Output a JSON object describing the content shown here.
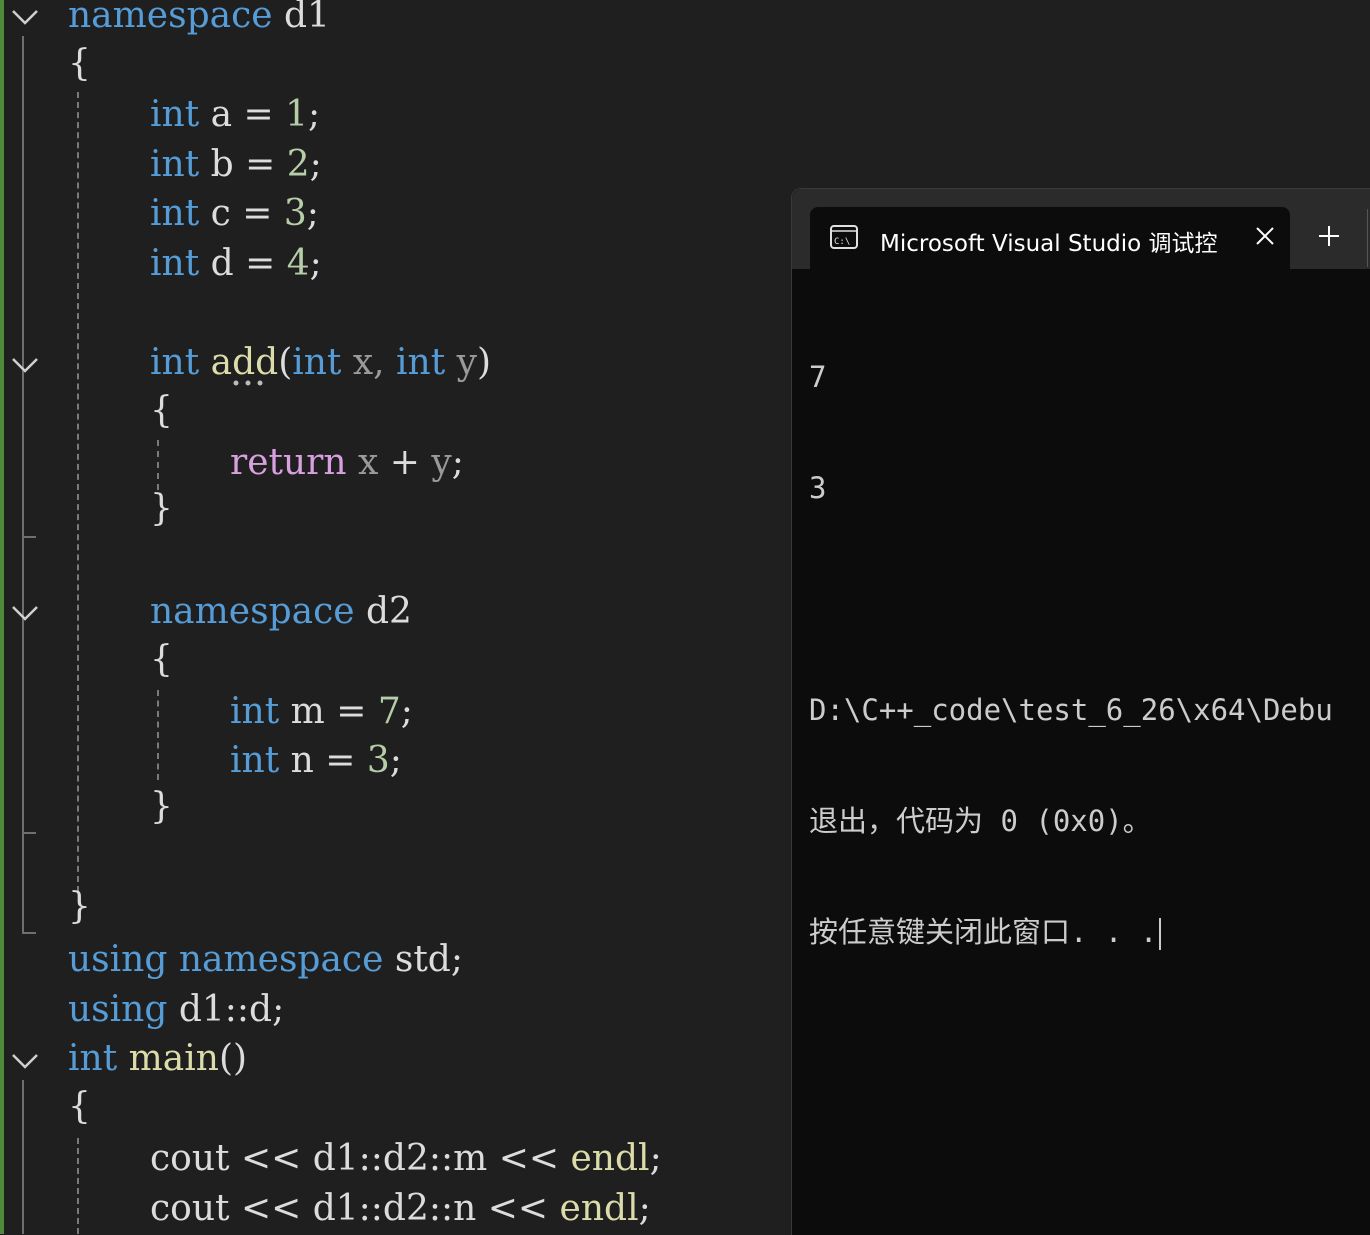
{
  "editor": {
    "lines": [
      {
        "tokens": [
          {
            "t": "namespace",
            "c": "kw"
          },
          {
            "t": " d1",
            "c": "id"
          }
        ]
      },
      {
        "tokens": [
          {
            "t": "{",
            "c": "op"
          }
        ]
      },
      {
        "tokens": [
          {
            "t": "int",
            "c": "kw"
          },
          {
            "t": " a ",
            "c": "id"
          },
          {
            "t": "= ",
            "c": "op"
          },
          {
            "t": "1",
            "c": "num"
          },
          {
            "t": ";",
            "c": "op"
          }
        ]
      },
      {
        "tokens": [
          {
            "t": "int",
            "c": "kw"
          },
          {
            "t": " b ",
            "c": "id"
          },
          {
            "t": "= ",
            "c": "op"
          },
          {
            "t": "2",
            "c": "num"
          },
          {
            "t": ";",
            "c": "op"
          }
        ]
      },
      {
        "tokens": [
          {
            "t": "int",
            "c": "kw"
          },
          {
            "t": " c ",
            "c": "id"
          },
          {
            "t": "= ",
            "c": "op"
          },
          {
            "t": "3",
            "c": "num"
          },
          {
            "t": ";",
            "c": "op"
          }
        ]
      },
      {
        "tokens": [
          {
            "t": "int",
            "c": "kw"
          },
          {
            "t": " d ",
            "c": "id"
          },
          {
            "t": "= ",
            "c": "op"
          },
          {
            "t": "4",
            "c": "num"
          },
          {
            "t": ";",
            "c": "op"
          }
        ]
      },
      {
        "tokens": [
          {
            "t": "int",
            "c": "kw"
          },
          {
            "t": " ",
            "c": "id"
          },
          {
            "t": "add",
            "c": "fn"
          },
          {
            "t": "(",
            "c": "op"
          },
          {
            "t": "int",
            "c": "kw"
          },
          {
            "t": " x, ",
            "c": "prm"
          },
          {
            "t": "int",
            "c": "kw"
          },
          {
            "t": " y",
            "c": "prm"
          },
          {
            "t": ")",
            "c": "op"
          }
        ]
      },
      {
        "tokens": [
          {
            "t": "{",
            "c": "op"
          }
        ]
      },
      {
        "tokens": [
          {
            "t": "return",
            "c": "ctl"
          },
          {
            "t": " x ",
            "c": "prm"
          },
          {
            "t": "+ ",
            "c": "op"
          },
          {
            "t": "y",
            "c": "prm"
          },
          {
            "t": ";",
            "c": "op"
          }
        ]
      },
      {
        "tokens": [
          {
            "t": "}",
            "c": "op"
          }
        ]
      },
      {
        "tokens": [
          {
            "t": "namespace",
            "c": "kw"
          },
          {
            "t": " d2",
            "c": "id"
          }
        ]
      },
      {
        "tokens": [
          {
            "t": "{",
            "c": "op"
          }
        ]
      },
      {
        "tokens": [
          {
            "t": "int",
            "c": "kw"
          },
          {
            "t": " m ",
            "c": "id"
          },
          {
            "t": "= ",
            "c": "op"
          },
          {
            "t": "7",
            "c": "num"
          },
          {
            "t": ";",
            "c": "op"
          }
        ]
      },
      {
        "tokens": [
          {
            "t": "int",
            "c": "kw"
          },
          {
            "t": " n ",
            "c": "id"
          },
          {
            "t": "= ",
            "c": "op"
          },
          {
            "t": "3",
            "c": "num"
          },
          {
            "t": ";",
            "c": "op"
          }
        ]
      },
      {
        "tokens": [
          {
            "t": "}",
            "c": "op"
          }
        ]
      },
      {
        "tokens": [
          {
            "t": "}",
            "c": "op"
          }
        ]
      },
      {
        "tokens": [
          {
            "t": "using",
            "c": "kw"
          },
          {
            "t": " ",
            "c": "id"
          },
          {
            "t": "namespace",
            "c": "kw"
          },
          {
            "t": " std;",
            "c": "id"
          }
        ]
      },
      {
        "tokens": [
          {
            "t": "using",
            "c": "kw"
          },
          {
            "t": " d1::d;",
            "c": "id"
          }
        ]
      },
      {
        "tokens": [
          {
            "t": "int",
            "c": "kw"
          },
          {
            "t": " ",
            "c": "id"
          },
          {
            "t": "main",
            "c": "fn"
          },
          {
            "t": "()",
            "c": "op"
          }
        ]
      },
      {
        "tokens": [
          {
            "t": "{",
            "c": "op"
          }
        ]
      },
      {
        "tokens": [
          {
            "t": "cout ",
            "c": "id"
          },
          {
            "t": "<< ",
            "c": "op"
          },
          {
            "t": "d1::d2::m ",
            "c": "id"
          },
          {
            "t": "<< ",
            "c": "op"
          },
          {
            "t": "endl",
            "c": "fn"
          },
          {
            "t": ";",
            "c": "op"
          }
        ]
      },
      {
        "tokens": [
          {
            "t": "cout ",
            "c": "id"
          },
          {
            "t": "<< ",
            "c": "op"
          },
          {
            "t": "d1::d2::n ",
            "c": "id"
          },
          {
            "t": "<< ",
            "c": "op"
          },
          {
            "t": "endl",
            "c": "fn"
          },
          {
            "t": ";",
            "c": "op"
          }
        ]
      }
    ],
    "collapse_icon": "chevron-down-icon"
  },
  "console": {
    "tab": {
      "title": "Microsoft Visual Studio 调试控",
      "icon": "terminal-icon",
      "close_icon": "close-icon",
      "new_tab_icon": "plus-icon"
    },
    "output": [
      "7",
      "3",
      "",
      "D:\\C++_code\\test_6_26\\x64\\Debu",
      "退出，代码为 0 (0x0)。",
      "按任意键关闭此窗口. . ."
    ]
  }
}
